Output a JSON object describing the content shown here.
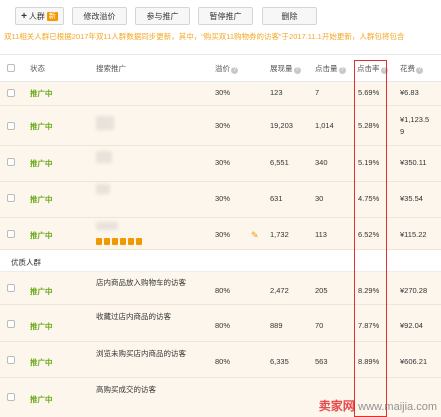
{
  "toolbar": {
    "add_label": "人群",
    "add_badge": "新",
    "modify_label": "修改溢价",
    "join_label": "参与推广",
    "pause_label": "暂停推广",
    "delete_label": "删除"
  },
  "notice": "双11相关人群已根据2017年双11人群数据同步更新，其中，“购买双11购物券的访客”于2017.11.1开始更新，人群包将包含",
  "table": {
    "headers": {
      "status": "状态",
      "name": "搜索推广",
      "premium": "溢价",
      "impressions": "展现量",
      "clicks": "点击量",
      "ctr": "点击率",
      "cost": "花费"
    },
    "rows": [
      {
        "status": "推广中",
        "name": "",
        "premium": "30%",
        "impressions": "123",
        "clicks": "7",
        "ctr": "5.69%",
        "cost": "¥6.83"
      },
      {
        "status": "推广中",
        "name": "",
        "premium": "30%",
        "impressions": "19,203",
        "clicks": "1,014",
        "ctr": "5.28%",
        "cost": "¥1,123.5",
        "cost2": "9"
      },
      {
        "status": "推广中",
        "name": "",
        "premium": "30%",
        "impressions": "6,551",
        "clicks": "340",
        "ctr": "5.19%",
        "cost": "¥350.11"
      },
      {
        "status": "推广中",
        "name": "",
        "premium": "30%",
        "impressions": "631",
        "clicks": "30",
        "ctr": "4.75%",
        "cost": "¥35.54"
      },
      {
        "status": "推广中",
        "name": "",
        "premium": "30%",
        "impressions": "1,732",
        "clicks": "113",
        "ctr": "6.52%",
        "cost": "¥115.22"
      }
    ],
    "section_title": "优质人群",
    "rows2": [
      {
        "status": "推广中",
        "name": "店内商品放入购物车的访客",
        "premium": "80%",
        "impressions": "2,472",
        "clicks": "205",
        "ctr": "8.29%",
        "cost": "¥270.28"
      },
      {
        "status": "推广中",
        "name": "收藏过店内商品的访客",
        "premium": "80%",
        "impressions": "889",
        "clicks": "70",
        "ctr": "7.87%",
        "cost": "¥92.04"
      },
      {
        "status": "推广中",
        "name": "浏览未购买店内商品的访客",
        "premium": "80%",
        "impressions": "6,335",
        "clicks": "563",
        "ctr": "8.89%",
        "cost": "¥606.21"
      },
      {
        "status": "推广中",
        "name": "高购买成交的访客",
        "premium": "",
        "impressions": "",
        "clicks": "",
        "ctr": "",
        "cost": ""
      }
    ]
  },
  "watermark": {
    "text1": "卖家网",
    "text2": "www.maijia.com"
  },
  "colors": {
    "accent": "#f39800",
    "status_green": "#6aaa1a",
    "row_bg": "#fdf6ec",
    "highlight_box": "#e0302a",
    "notice": "#f5a623"
  }
}
